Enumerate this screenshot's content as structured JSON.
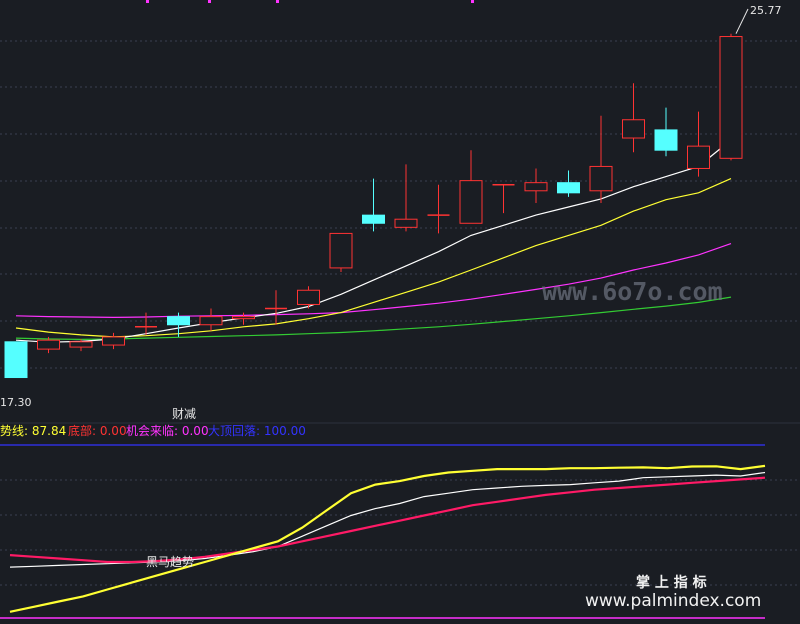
{
  "chart_data": {
    "type": "candlestick",
    "price_axis": {
      "ymin": 16.5,
      "ymax": 26.6
    },
    "labels": {
      "high_label": "25.77",
      "low_label": "17.30",
      "signal_label": "财减"
    },
    "candles": [
      {
        "o": 18.18,
        "h": 18.18,
        "l": 17.3,
        "c": 17.3
      },
      {
        "o": 18.0,
        "h": 18.3,
        "l": 17.9,
        "c": 18.22
      },
      {
        "o": 18.05,
        "h": 18.25,
        "l": 17.95,
        "c": 18.18
      },
      {
        "o": 18.1,
        "h": 18.4,
        "l": 18.0,
        "c": 18.3
      },
      {
        "o": 18.55,
        "h": 18.9,
        "l": 18.35,
        "c": 18.55
      },
      {
        "o": 18.8,
        "h": 18.9,
        "l": 18.3,
        "c": 18.6
      },
      {
        "o": 18.6,
        "h": 19.0,
        "l": 18.45,
        "c": 18.8
      },
      {
        "o": 18.75,
        "h": 18.9,
        "l": 18.6,
        "c": 18.8
      },
      {
        "o": 19.0,
        "h": 19.45,
        "l": 18.6,
        "c": 19.0
      },
      {
        "o": 19.1,
        "h": 19.55,
        "l": 19.0,
        "c": 19.45
      },
      {
        "o": 20.0,
        "h": 20.7,
        "l": 19.9,
        "c": 20.85
      },
      {
        "o": 21.3,
        "h": 22.2,
        "l": 20.9,
        "c": 21.1
      },
      {
        "o": 21.0,
        "h": 22.55,
        "l": 20.9,
        "c": 21.2
      },
      {
        "o": 21.3,
        "h": 22.05,
        "l": 20.85,
        "c": 21.3
      },
      {
        "o": 21.1,
        "h": 22.9,
        "l": 21.1,
        "c": 22.15
      },
      {
        "o": 22.05,
        "h": 22.05,
        "l": 21.35,
        "c": 22.05
      },
      {
        "o": 21.9,
        "h": 22.45,
        "l": 21.6,
        "c": 22.1
      },
      {
        "o": 22.1,
        "h": 22.4,
        "l": 21.75,
        "c": 21.85
      },
      {
        "o": 21.9,
        "h": 23.75,
        "l": 21.6,
        "c": 22.5
      },
      {
        "o": 23.2,
        "h": 24.55,
        "l": 22.85,
        "c": 23.65
      },
      {
        "o": 23.4,
        "h": 23.95,
        "l": 22.75,
        "c": 22.9
      },
      {
        "o": 22.45,
        "h": 23.85,
        "l": 22.25,
        "c": 23.0
      },
      {
        "o": 22.7,
        "h": 25.77,
        "l": 22.65,
        "c": 25.7
      }
    ],
    "ma_short": [
      18.22,
      18.17,
      18.19,
      18.25,
      18.38,
      18.52,
      18.65,
      18.77,
      18.88,
      19.05,
      19.35,
      19.7,
      20.05,
      20.4,
      20.8,
      21.05,
      21.3,
      21.5,
      21.7,
      22.0,
      22.25,
      22.5,
      23.15
    ],
    "ma_mid": [
      18.52,
      18.42,
      18.35,
      18.3,
      18.33,
      18.38,
      18.45,
      18.55,
      18.62,
      18.75,
      18.9,
      19.15,
      19.4,
      19.65,
      19.95,
      20.25,
      20.55,
      20.8,
      21.05,
      21.4,
      21.68,
      21.85,
      22.2
    ],
    "ma_long": [
      18.82,
      18.8,
      18.79,
      18.78,
      18.79,
      18.81,
      18.82,
      18.83,
      18.85,
      18.87,
      18.9,
      18.97,
      19.05,
      19.13,
      19.23,
      19.35,
      19.47,
      19.6,
      19.75,
      19.95,
      20.12,
      20.32,
      20.6
    ],
    "ma_slow": [
      18.27,
      18.25,
      18.24,
      18.25,
      18.27,
      18.29,
      18.31,
      18.33,
      18.35,
      18.38,
      18.41,
      18.45,
      18.5,
      18.55,
      18.61,
      18.68,
      18.75,
      18.82,
      18.9,
      18.98,
      19.06,
      19.15,
      19.28
    ],
    "indicator": {
      "ymin": 0,
      "ymax": 100,
      "legend": [
        {
          "text": "势线: 87.84",
          "color": "#ffff33"
        },
        {
          "text": "底部: 0.00",
          "color": "#ff3333"
        },
        {
          "text": "机会来临: 0.00",
          "color": "#ff33ff"
        },
        {
          "text": "大顶回落: 100.00",
          "color": "#3333ff"
        }
      ],
      "top_line": 100,
      "bottom_line": 0,
      "trend_yellow": [
        3,
        6,
        9,
        12,
        16,
        20,
        24,
        28,
        32,
        36,
        40,
        44,
        52,
        62,
        72,
        77,
        79,
        82,
        84,
        85,
        86,
        86,
        86,
        86.5,
        86.5,
        86.8,
        87,
        86.5,
        87.5,
        87.6,
        86,
        87.84
      ],
      "trend_white": [
        29,
        29.5,
        30,
        30.5,
        31,
        31.5,
        32,
        32.8,
        34,
        36,
        38,
        41,
        47,
        53,
        59,
        63,
        66,
        70,
        72,
        74,
        75,
        76,
        76.5,
        77,
        78,
        79,
        81,
        81.5,
        82,
        82.5,
        82,
        84
      ],
      "trend_pink": [
        36,
        35,
        34,
        33,
        32,
        32,
        32.5,
        33.5,
        35,
        37,
        39,
        41,
        44,
        47,
        50,
        53,
        56,
        59,
        62,
        65,
        67,
        69,
        71,
        72.5,
        74,
        75,
        76,
        77,
        78,
        79,
        80,
        81
      ],
      "label_text": "黑马趋势"
    }
  },
  "watermarks": {
    "site1": "www.6o7o.com",
    "brand_cn": "掌 上 指 标",
    "site2": "www.palmindex.com"
  },
  "colors": {
    "up": "#ff3333",
    "down": "#55ffff",
    "ma_short": "#ffffff",
    "ma_mid": "#ffff33",
    "ma_long": "#ff33ff",
    "ma_slow": "#33cc33",
    "grid": "#3a4050"
  }
}
